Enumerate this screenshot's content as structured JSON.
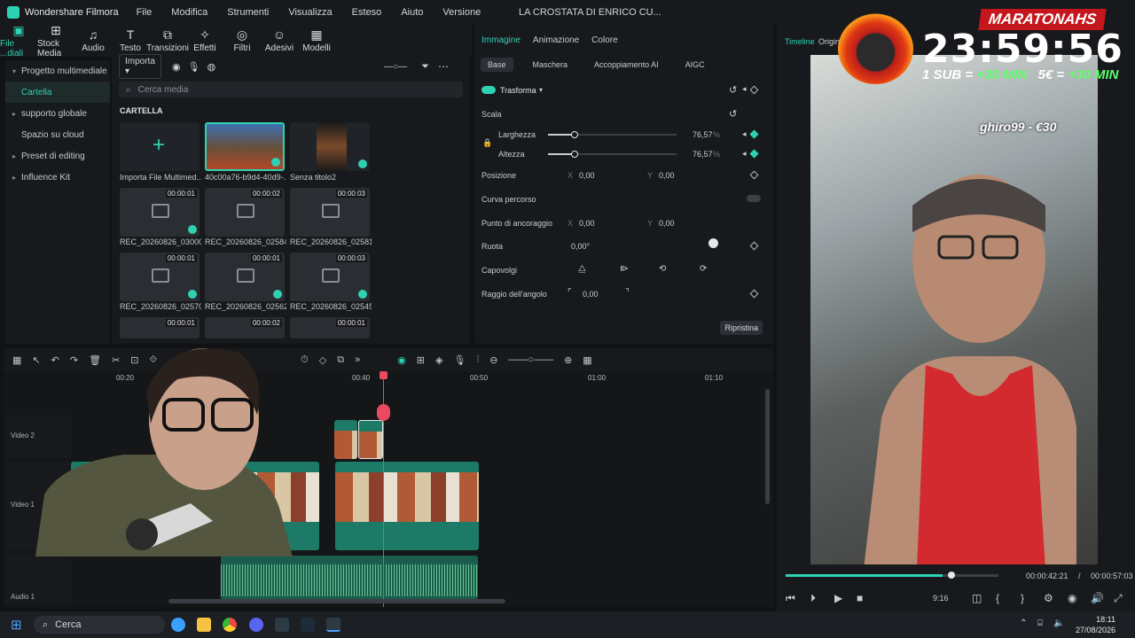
{
  "app": {
    "name": "Wondershare Filmora",
    "menu": [
      "File",
      "Modifica",
      "Strumenti",
      "Visualizza",
      "Esteso",
      "Aiuto",
      "Versione"
    ],
    "document_title": "LA CROSTATA DI ENRICO CU..."
  },
  "toolbar": {
    "items": [
      {
        "label": "File ...diali",
        "icon": "media-icon"
      },
      {
        "label": "Stock Media",
        "icon": "stock-icon"
      },
      {
        "label": "Audio",
        "icon": "music-icon"
      },
      {
        "label": "Testo",
        "icon": "text-icon"
      },
      {
        "label": "Transizioni",
        "icon": "transition-icon"
      },
      {
        "label": "Effetti",
        "icon": "effects-icon"
      },
      {
        "label": "Filtri",
        "icon": "filter-icon"
      },
      {
        "label": "Adesivi",
        "icon": "sticker-icon"
      },
      {
        "label": "Modelli",
        "icon": "template-icon"
      }
    ]
  },
  "sidebar": {
    "items": [
      {
        "label": "Progetto multimediale"
      },
      {
        "label": "Cartella"
      },
      {
        "label": "supporto globale"
      },
      {
        "label": "Spazio su cloud"
      },
      {
        "label": "Preset di editing"
      },
      {
        "label": "Influence Kit"
      }
    ]
  },
  "media": {
    "import_label": "Importa",
    "search_placeholder": "Cerca media",
    "section": "CARTELLA",
    "items": [
      {
        "label": "Importa File Multimed...",
        "duration": ""
      },
      {
        "label": "40c00a76-b9d4-40d9-...",
        "duration": ""
      },
      {
        "label": "Senza titolo2",
        "duration": ""
      },
      {
        "label": "REC_20260826_030001",
        "duration": "00:00:01"
      },
      {
        "label": "REC_20260826_025841",
        "duration": "00:00:02"
      },
      {
        "label": "REC_20260826_025813",
        "duration": "00:00:03"
      },
      {
        "label": "REC_20260826_025709",
        "duration": "00:00:01"
      },
      {
        "label": "REC_20260826_025620",
        "duration": "00:00:01"
      },
      {
        "label": "REC_20260826_025455",
        "duration": "00:00:03"
      },
      {
        "label": "",
        "duration": "00:00:01"
      },
      {
        "label": "",
        "duration": "00:00:02"
      },
      {
        "label": "",
        "duration": "00:00:01"
      }
    ]
  },
  "properties": {
    "tabs": [
      "Immagine",
      "Animazione",
      "Colore"
    ],
    "subtabs": [
      "Base",
      "Maschera",
      "Accoppiamento AI",
      "AIGC"
    ],
    "transform_label": "Trasforma",
    "scale_label": "Scala",
    "width_label": "Larghezza",
    "width_value": "76,57",
    "height_label": "Altezza",
    "height_value": "76,57",
    "unit": "%",
    "position_label": "Posizione",
    "pos_x": "0,00",
    "pos_y": "0,00",
    "path_curve_label": "Curva percorso",
    "anchor_label": "Punto di ancoraggio",
    "anchor_x": "0,00",
    "anchor_y": "0,00",
    "rotate_label": "Ruota",
    "rotate_value": "0,00°",
    "flip_label": "Capovolgi",
    "corner_label": "Raggio dell'angolo",
    "corner_value": "0,00",
    "reset_label": "Ripristina",
    "x_label": "X",
    "y_label": "Y",
    "scale_fraction": 0.77
  },
  "preview": {
    "tabs": [
      "Timeline",
      "Origin"
    ],
    "current_time": "00:00:42:21",
    "separator": "/",
    "total_time": "00:00:57:03",
    "ratio": "9:16",
    "progress": 0.74
  },
  "overlay": {
    "banner": "MARATONAHS",
    "timer": "23:59:56",
    "sub_text": "1 SUB = ",
    "sub_bonus": "+30 MIN",
    "euro_text": "5€ = ",
    "euro_bonus": "+30 MIN",
    "donation": "ghiro99 - €30"
  },
  "timeline": {
    "ruler": [
      "00:20",
      "00:40",
      "00:50",
      "01:00",
      "01:10"
    ],
    "tracks": [
      "Video 2",
      "Video 1",
      "Audio 1"
    ]
  },
  "taskbar": {
    "search_label": "Cerca",
    "time": "18:11",
    "date": "27/08/2026"
  },
  "colors": {
    "accent": "#2fd1b3",
    "playhead": "#e84a5f",
    "banner_red": "#c4161c",
    "bonus_green": "#5cff6a"
  }
}
